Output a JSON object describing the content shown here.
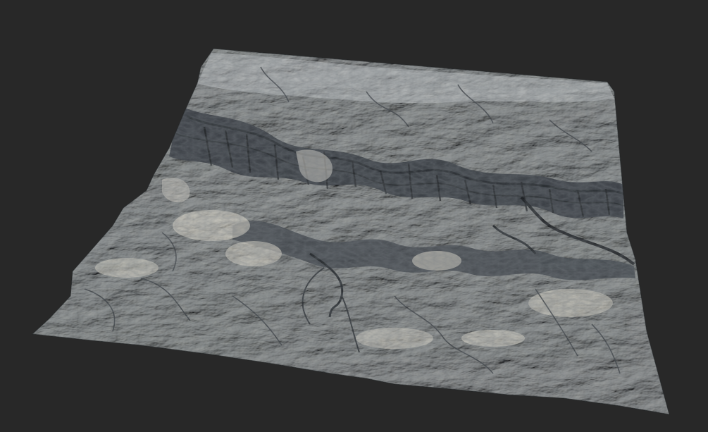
{
  "scene": {
    "background_color": "#282828",
    "terrain_base_color": "#a9aeb2",
    "terrain_highlight_color": "#d6d2c6",
    "terrain_shadow_color": "#2f3439",
    "subject": "terrain-heightmap-render"
  }
}
